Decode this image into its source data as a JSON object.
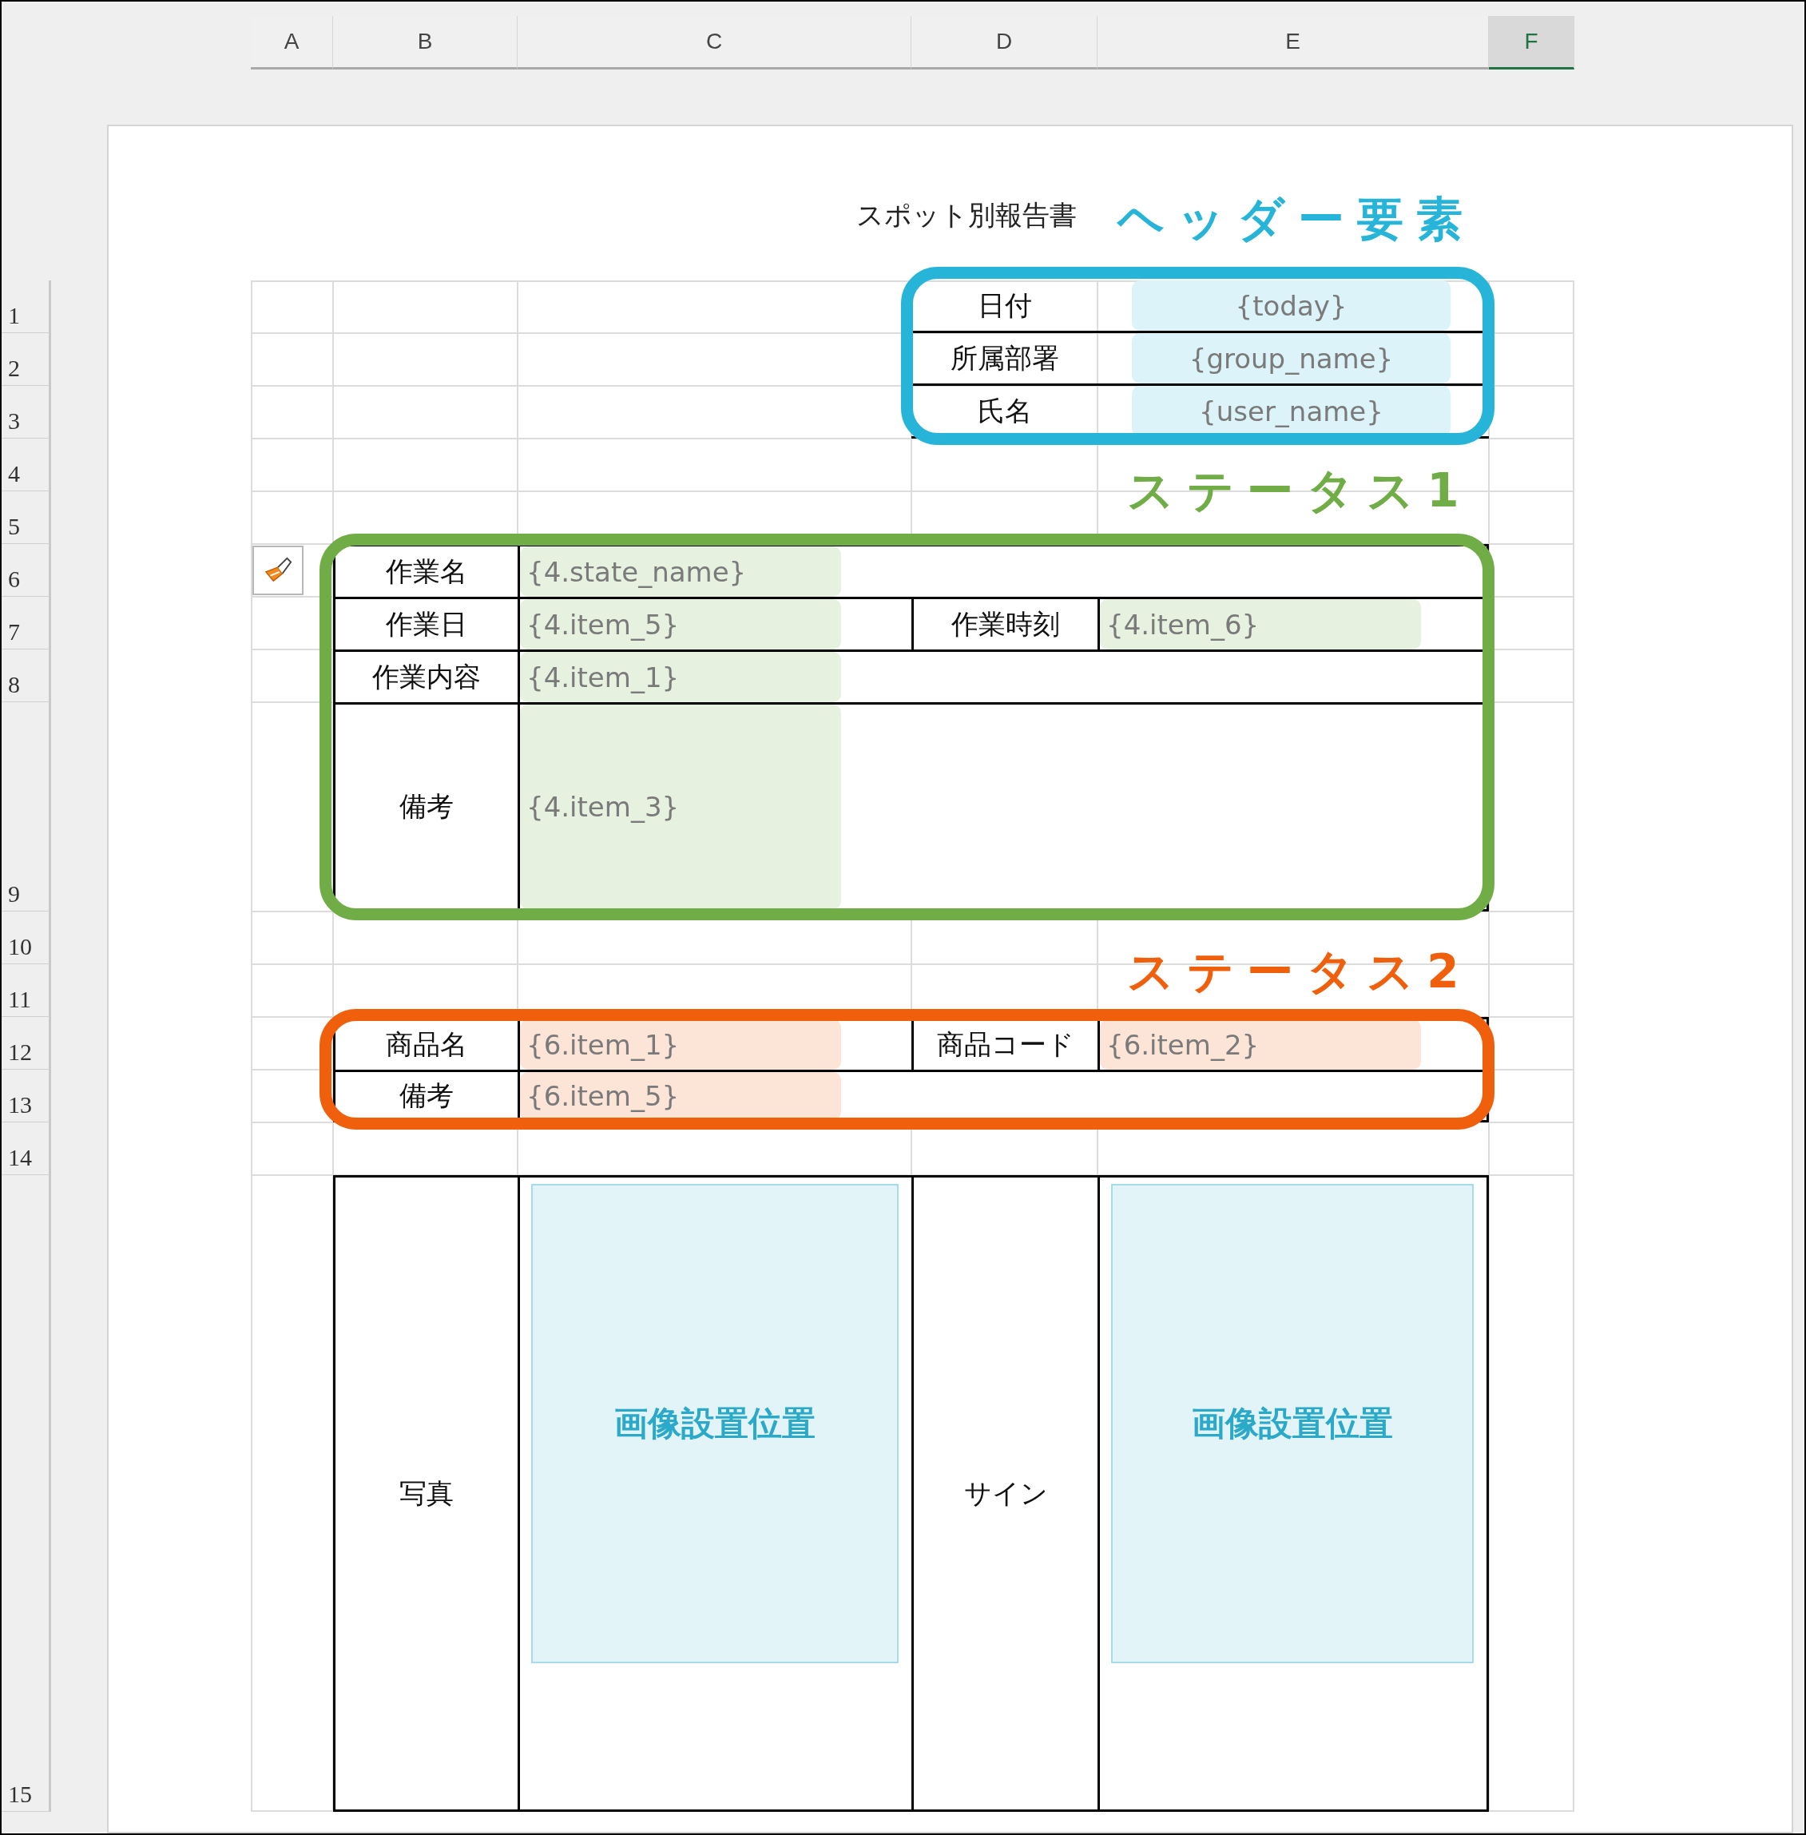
{
  "column_headers": [
    {
      "label": "A",
      "selected": false
    },
    {
      "label": "B",
      "selected": false
    },
    {
      "label": "C",
      "selected": false
    },
    {
      "label": "D",
      "selected": false
    },
    {
      "label": "E",
      "selected": false
    },
    {
      "label": "F",
      "selected": true
    }
  ],
  "row_headers": [
    "1",
    "2",
    "3",
    "4",
    "5",
    "6",
    "7",
    "8",
    "9",
    "10",
    "11",
    "12",
    "13",
    "14",
    "15"
  ],
  "title": "スポット別報告書",
  "header_section": {
    "annotation": {
      "label": "ヘッダー要素",
      "color": "#26b4d8"
    },
    "fields": [
      {
        "label": "日付",
        "value": "{today}"
      },
      {
        "label": "所属部署",
        "value": "{group_name}"
      },
      {
        "label": "氏名",
        "value": "{user_name}"
      }
    ]
  },
  "status_1": {
    "annotation": {
      "label": "ステータス1",
      "color": "#70ad47"
    },
    "rows": [
      {
        "fields": [
          {
            "label": "作業名",
            "value": "{4.state_name}"
          }
        ]
      },
      {
        "fields": [
          {
            "label": "作業日",
            "value": "{4.item_5}"
          },
          {
            "label": "作業時刻",
            "value": "{4.item_6}"
          }
        ]
      },
      {
        "fields": [
          {
            "label": "作業内容",
            "value": "{4.item_1}"
          }
        ]
      },
      {
        "fields": [
          {
            "label": "備考",
            "value": "{4.item_3}"
          }
        ]
      }
    ]
  },
  "status_2": {
    "annotation": {
      "label": "ステータス2",
      "color": "#f0600c"
    },
    "rows": [
      {
        "fields": [
          {
            "label": "商品名",
            "value": "{6.item_1}"
          },
          {
            "label": "商品コード",
            "value": "{6.item_2}"
          }
        ]
      },
      {
        "fields": [
          {
            "label": "備考",
            "value": "{6.item_5}"
          }
        ]
      }
    ]
  },
  "image_section": {
    "fields": [
      {
        "label": "写真",
        "slot_text": "画像設置位置"
      },
      {
        "label": "サイン",
        "slot_text": "画像設置位置"
      }
    ]
  }
}
